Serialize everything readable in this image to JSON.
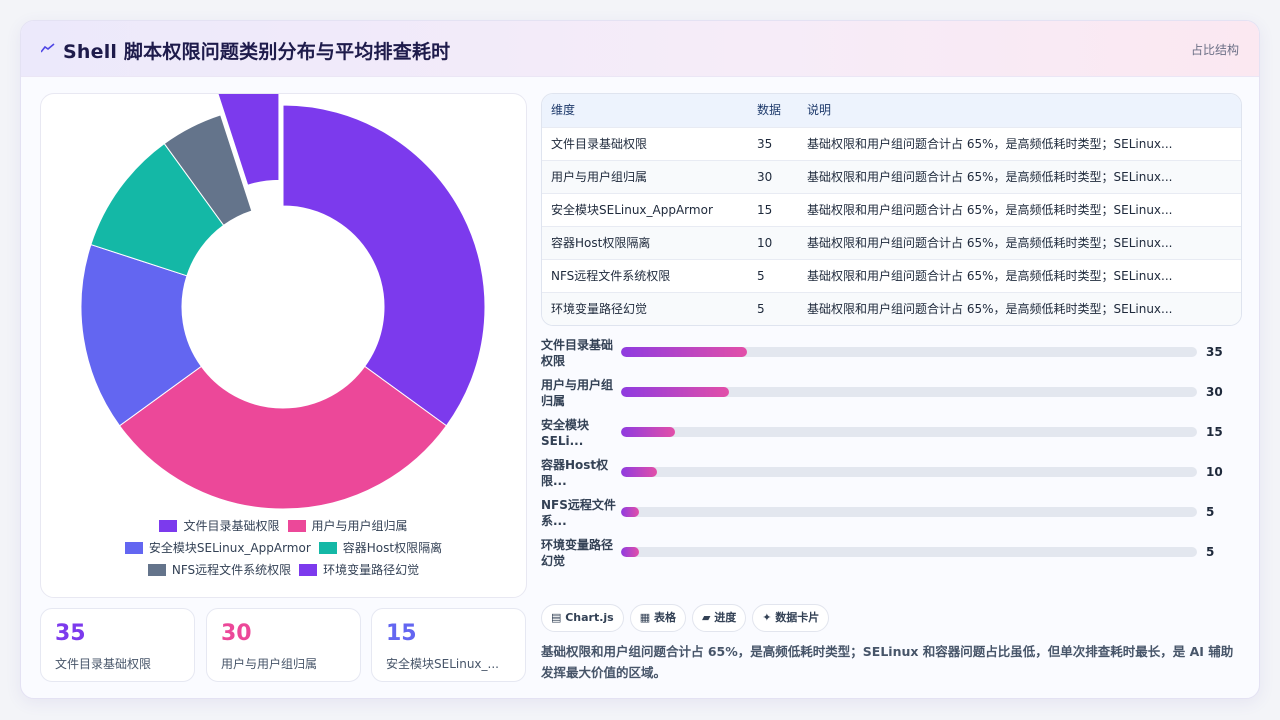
{
  "header": {
    "title": "Shell 脚本权限问题类别分布与平均排查耗时",
    "link": "占比结构"
  },
  "chart_data": {
    "type": "pie",
    "categories": [
      "文件目录基础权限",
      "用户与用户组归属",
      "安全模块SELinux_AppArmor",
      "容器Host权限隔离",
      "NFS远程文件系统权限",
      "环境变量路径幻觉"
    ],
    "values": [
      35,
      30,
      15,
      10,
      5,
      5
    ],
    "colors": [
      "#7c3aed",
      "#ec4899",
      "#6366f1",
      "#14b8a6",
      "#64748b",
      "#7c3aed"
    ],
    "legend_position": "bottom",
    "title": "",
    "xlabel": "",
    "ylabel": ""
  },
  "legend_items": [
    "文件目录基础权限",
    "用户与用户组归属",
    "安全模块SELinux_AppArmor",
    "容器Host权限隔离",
    "NFS远程文件系统权限",
    "环境变量路径幻觉"
  ],
  "kpis": [
    {
      "value": "35",
      "label": "文件目录基础权限",
      "color": "#7c3aed"
    },
    {
      "value": "30",
      "label": "用户与用户组归属",
      "color": "#ec4899"
    },
    {
      "value": "15",
      "label": "安全模块SELinux_...",
      "color": "#6366f1"
    }
  ],
  "table": {
    "headers": [
      "维度",
      "数据",
      "说明"
    ],
    "rows": [
      [
        "文件目录基础权限",
        "35",
        "基础权限和用户组问题合计占 65%，是高频低耗时类型；SELinux..."
      ],
      [
        "用户与用户组归属",
        "30",
        "基础权限和用户组问题合计占 65%，是高频低耗时类型；SELinux..."
      ],
      [
        "安全模块SELinux_AppArmor",
        "15",
        "基础权限和用户组问题合计占 65%，是高频低耗时类型；SELinux..."
      ],
      [
        "容器Host权限隔离",
        "10",
        "基础权限和用户组问题合计占 65%，是高频低耗时类型；SELinux..."
      ],
      [
        "NFS远程文件系统权限",
        "5",
        "基础权限和用户组问题合计占 65%，是高频低耗时类型；SELinux..."
      ],
      [
        "环境变量路径幻觉",
        "5",
        "基础权限和用户组问题合计占 65%，是高频低耗时类型；SELinux..."
      ]
    ]
  },
  "bars": [
    {
      "label": "文件目录基础\n权限",
      "value": "35"
    },
    {
      "label": "用户与用户组\n归属",
      "value": "30"
    },
    {
      "label": "安全模块\nSELi...",
      "value": "15"
    },
    {
      "label": "容器Host权\n限...",
      "value": "10"
    },
    {
      "label": "NFS远程文件\n系...",
      "value": "5"
    },
    {
      "label": "环境变量路径\n幻觉",
      "value": "5"
    }
  ],
  "bar_max": 160,
  "chips": [
    "▤ Chart.js",
    "▦ 表格",
    "▰ 进度",
    "✦ 数据卡片"
  ],
  "summary": "基础权限和用户组问题合计占 65%，是高频低耗时类型；SELinux 和容器问题占比虽低，但单次排查耗时最长，是 AI 辅助发挥最大价值的区域。"
}
